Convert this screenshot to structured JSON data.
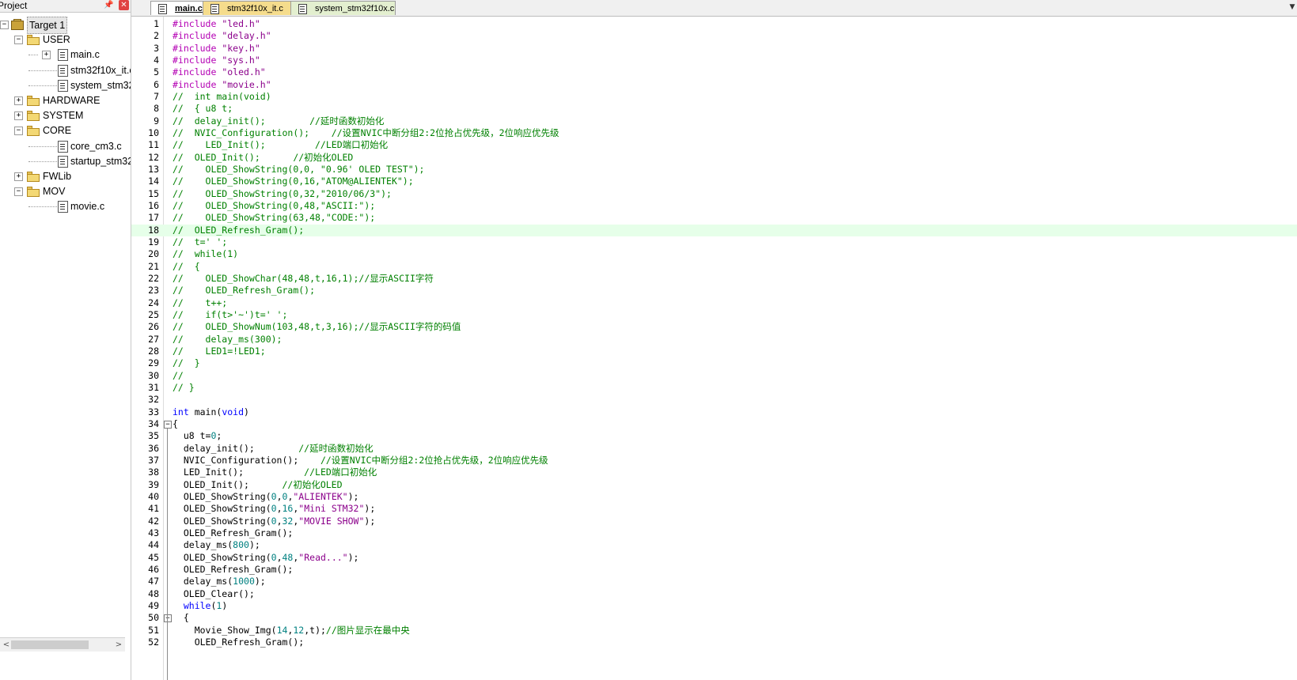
{
  "project_pane": {
    "title": "Project",
    "pin_glyph": "📌",
    "close_glyph": "✕",
    "tree": [
      {
        "label": "Target 1",
        "kind": "target",
        "level": 0,
        "expanded": true
      },
      {
        "label": "USER",
        "kind": "folder",
        "level": 1,
        "expanded": true
      },
      {
        "label": "main.c",
        "kind": "file",
        "level": 2,
        "expandable": true
      },
      {
        "label": "stm32f10x_it.c",
        "kind": "file",
        "level": 2
      },
      {
        "label": "system_stm32f1",
        "kind": "file",
        "level": 2
      },
      {
        "label": "HARDWARE",
        "kind": "folder",
        "level": 1,
        "expanded": false
      },
      {
        "label": "SYSTEM",
        "kind": "folder",
        "level": 1,
        "expanded": false
      },
      {
        "label": "CORE",
        "kind": "folder",
        "level": 1,
        "expanded": true
      },
      {
        "label": "core_cm3.c",
        "kind": "file",
        "level": 2
      },
      {
        "label": "startup_stm32f1",
        "kind": "file",
        "level": 2
      },
      {
        "label": "FWLib",
        "kind": "folder",
        "level": 1,
        "expanded": false
      },
      {
        "label": "MOV",
        "kind": "folder",
        "level": 1,
        "expanded": true
      },
      {
        "label": "movie.c",
        "kind": "file",
        "level": 2
      }
    ],
    "scroll_left_glyph": "<",
    "scroll_right_glyph": ">"
  },
  "tabs": [
    {
      "label": "main.c",
      "active": true
    },
    {
      "label": "stm32f10x_it.c",
      "active": false
    },
    {
      "label": "system_stm32f10x.c",
      "active": false
    }
  ],
  "tab_dropdown_glyph": "▼",
  "editor": {
    "highlighted_line": 18,
    "lines": [
      {
        "n": "1",
        "tokens": [
          [
            "pre",
            "#include "
          ],
          [
            "str",
            "\"led.h\""
          ]
        ]
      },
      {
        "n": "2",
        "tokens": [
          [
            "pre",
            "#include "
          ],
          [
            "str",
            "\"delay.h\""
          ]
        ]
      },
      {
        "n": "3",
        "tokens": [
          [
            "pre",
            "#include "
          ],
          [
            "str",
            "\"key.h\""
          ]
        ]
      },
      {
        "n": "4",
        "tokens": [
          [
            "pre",
            "#include "
          ],
          [
            "str",
            "\"sys.h\""
          ]
        ]
      },
      {
        "n": "5",
        "tokens": [
          [
            "pre",
            "#include "
          ],
          [
            "str",
            "\"oled.h\""
          ]
        ]
      },
      {
        "n": "6",
        "tokens": [
          [
            "pre",
            "#include "
          ],
          [
            "str",
            "\"movie.h\""
          ]
        ]
      },
      {
        "n": "7",
        "tokens": [
          [
            "cmt",
            "//  int main(void)"
          ]
        ]
      },
      {
        "n": "8",
        "tokens": [
          [
            "cmt",
            "//  { u8 t;"
          ]
        ]
      },
      {
        "n": "9",
        "tokens": [
          [
            "cmt",
            "//  delay_init();        //延时函数初始化"
          ]
        ]
      },
      {
        "n": "10",
        "tokens": [
          [
            "cmt",
            "//  NVIC_Configuration();    //设置NVIC中断分组2:2位抢占优先级，2位响应优先级"
          ]
        ]
      },
      {
        "n": "11",
        "tokens": [
          [
            "cmt",
            "//    LED_Init();         //LED端口初始化"
          ]
        ]
      },
      {
        "n": "12",
        "tokens": [
          [
            "cmt",
            "//  OLED_Init();      //初始化OLED"
          ]
        ]
      },
      {
        "n": "13",
        "tokens": [
          [
            "cmt",
            "//    OLED_ShowString(0,0, \"0.96' OLED TEST\");"
          ]
        ]
      },
      {
        "n": "14",
        "tokens": [
          [
            "cmt",
            "//    OLED_ShowString(0,16,\"ATOM@ALIENTEK\");"
          ]
        ]
      },
      {
        "n": "15",
        "tokens": [
          [
            "cmt",
            "//    OLED_ShowString(0,32,\"2010/06/3\");"
          ]
        ]
      },
      {
        "n": "16",
        "tokens": [
          [
            "cmt",
            "//    OLED_ShowString(0,48,\"ASCII:\");"
          ]
        ]
      },
      {
        "n": "17",
        "tokens": [
          [
            "cmt",
            "//    OLED_ShowString(63,48,\"CODE:\");"
          ]
        ]
      },
      {
        "n": "18",
        "tokens": [
          [
            "cmt",
            "//  OLED_Refresh_Gram();"
          ]
        ]
      },
      {
        "n": "19",
        "tokens": [
          [
            "cmt",
            "//  t=' ';"
          ]
        ]
      },
      {
        "n": "20",
        "tokens": [
          [
            "cmt",
            "//  while(1)"
          ]
        ]
      },
      {
        "n": "21",
        "tokens": [
          [
            "cmt",
            "//  {"
          ]
        ]
      },
      {
        "n": "22",
        "tokens": [
          [
            "cmt",
            "//    OLED_ShowChar(48,48,t,16,1);//显示ASCII字符"
          ]
        ]
      },
      {
        "n": "23",
        "tokens": [
          [
            "cmt",
            "//    OLED_Refresh_Gram();"
          ]
        ]
      },
      {
        "n": "24",
        "tokens": [
          [
            "cmt",
            "//    t++;"
          ]
        ]
      },
      {
        "n": "25",
        "tokens": [
          [
            "cmt",
            "//    if(t>'~')t=' ';"
          ]
        ]
      },
      {
        "n": "26",
        "tokens": [
          [
            "cmt",
            "//    OLED_ShowNum(103,48,t,3,16);//显示ASCII字符的码值"
          ]
        ]
      },
      {
        "n": "27",
        "tokens": [
          [
            "cmt",
            "//    delay_ms(300);"
          ]
        ]
      },
      {
        "n": "28",
        "tokens": [
          [
            "cmt",
            "//    LED1=!LED1;"
          ]
        ]
      },
      {
        "n": "29",
        "tokens": [
          [
            "cmt",
            "//  }"
          ]
        ]
      },
      {
        "n": "30",
        "tokens": [
          [
            "cmt",
            "//"
          ]
        ]
      },
      {
        "n": "31",
        "tokens": [
          [
            "cmt",
            "// }"
          ]
        ]
      },
      {
        "n": "32",
        "tokens": []
      },
      {
        "n": "33",
        "tokens": [
          [
            "kw",
            "int"
          ],
          [
            "plain",
            " main("
          ],
          [
            "kw",
            "void"
          ],
          [
            "plain",
            ")"
          ]
        ]
      },
      {
        "n": "34",
        "fold": "−",
        "tokens": [
          [
            "plain",
            "{"
          ]
        ]
      },
      {
        "n": "35",
        "tokens": [
          [
            "plain",
            "  u8 t="
          ],
          [
            "num",
            "0"
          ],
          [
            "plain",
            ";"
          ]
        ]
      },
      {
        "n": "36",
        "tokens": [
          [
            "plain",
            "  delay_init();        "
          ],
          [
            "cmt",
            "//延时函数初始化"
          ]
        ]
      },
      {
        "n": "37",
        "tokens": [
          [
            "plain",
            "  NVIC_Configuration();    "
          ],
          [
            "cmt",
            "//设置NVIC中断分组2:2位抢占优先级，2位响应优先级"
          ]
        ]
      },
      {
        "n": "38",
        "tokens": [
          [
            "plain",
            "  LED_Init();           "
          ],
          [
            "cmt",
            "//LED端口初始化"
          ]
        ]
      },
      {
        "n": "39",
        "tokens": [
          [
            "plain",
            "  OLED_Init();      "
          ],
          [
            "cmt",
            "//初始化OLED"
          ]
        ]
      },
      {
        "n": "40",
        "tokens": [
          [
            "plain",
            "  OLED_ShowString("
          ],
          [
            "num",
            "0"
          ],
          [
            "plain",
            ","
          ],
          [
            "num",
            "0"
          ],
          [
            "plain",
            ","
          ],
          [
            "str",
            "\"ALIENTEK\""
          ],
          [
            "plain",
            ");"
          ]
        ]
      },
      {
        "n": "41",
        "tokens": [
          [
            "plain",
            "  OLED_ShowString("
          ],
          [
            "num",
            "0"
          ],
          [
            "plain",
            ","
          ],
          [
            "num",
            "16"
          ],
          [
            "plain",
            ","
          ],
          [
            "str",
            "\"Mini STM32\""
          ],
          [
            "plain",
            ");"
          ]
        ]
      },
      {
        "n": "42",
        "tokens": [
          [
            "plain",
            "  OLED_ShowString("
          ],
          [
            "num",
            "0"
          ],
          [
            "plain",
            ","
          ],
          [
            "num",
            "32"
          ],
          [
            "plain",
            ","
          ],
          [
            "str",
            "\"MOVIE SHOW\""
          ],
          [
            "plain",
            ");"
          ]
        ]
      },
      {
        "n": "43",
        "tokens": [
          [
            "plain",
            "  OLED_Refresh_Gram();"
          ]
        ]
      },
      {
        "n": "44",
        "tokens": [
          [
            "plain",
            "  delay_ms("
          ],
          [
            "num",
            "800"
          ],
          [
            "plain",
            ");"
          ]
        ]
      },
      {
        "n": "45",
        "tokens": [
          [
            "plain",
            "  OLED_ShowString("
          ],
          [
            "num",
            "0"
          ],
          [
            "plain",
            ","
          ],
          [
            "num",
            "48"
          ],
          [
            "plain",
            ","
          ],
          [
            "str",
            "\"Read...\""
          ],
          [
            "plain",
            ");"
          ]
        ]
      },
      {
        "n": "46",
        "tokens": [
          [
            "plain",
            "  OLED_Refresh_Gram();"
          ]
        ]
      },
      {
        "n": "47",
        "tokens": [
          [
            "plain",
            "  delay_ms("
          ],
          [
            "num",
            "1000"
          ],
          [
            "plain",
            ");"
          ]
        ]
      },
      {
        "n": "48",
        "tokens": [
          [
            "plain",
            "  OLED_Clear();"
          ]
        ]
      },
      {
        "n": "49",
        "tokens": [
          [
            "plain",
            "  "
          ],
          [
            "kw",
            "while"
          ],
          [
            "plain",
            "("
          ],
          [
            "num",
            "1"
          ],
          [
            "plain",
            ")"
          ]
        ]
      },
      {
        "n": "50",
        "fold": "−",
        "tokens": [
          [
            "plain",
            "  {"
          ]
        ]
      },
      {
        "n": "51",
        "tokens": [
          [
            "plain",
            "    Movie_Show_Img("
          ],
          [
            "num",
            "14"
          ],
          [
            "plain",
            ","
          ],
          [
            "num",
            "12"
          ],
          [
            "plain",
            ",t);"
          ],
          [
            "cmt",
            "//图片显示在最中央"
          ]
        ]
      },
      {
        "n": "52",
        "tokens": [
          [
            "plain",
            "    OLED_Refresh_Gram();"
          ]
        ]
      }
    ]
  }
}
